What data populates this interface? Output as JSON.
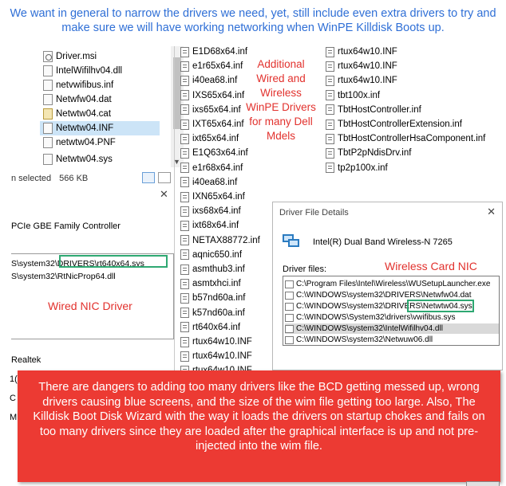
{
  "header": {
    "text": "We want in general to narrow the drivers we need, yet, still include even extra drivers to try and make sure we will have working networking when WinPE Killdisk Boots up."
  },
  "explorer": {
    "files": [
      {
        "name": "Driver.msi",
        "icon": "installer-icon"
      },
      {
        "name": "IntelWifilhv04.dll",
        "icon": "dll-icon"
      },
      {
        "name": "netvwifibus.inf",
        "icon": "inf-icon"
      },
      {
        "name": "Netwfw04.dat",
        "icon": "file-icon"
      },
      {
        "name": "Netwtw04.cat",
        "icon": "catalog-icon"
      },
      {
        "name": "Netwtw04.INF",
        "icon": "inf-icon",
        "selected": true
      },
      {
        "name": "netwtw04.PNF",
        "icon": "file-icon"
      },
      {
        "name": "Netwtw04.sys",
        "icon": "sys-icon"
      }
    ],
    "status": {
      "selected": "n selected",
      "size": "566 KB"
    }
  },
  "left_panel": {
    "device": "PCIe GBE Family Controller",
    "driver_rows": [
      "S\\system32\\DRIVERS\\rt640x64.sys",
      "S\\system32\\RtNicProp64.dll"
    ],
    "wired_label": "Wired NIC Driver",
    "provider": "Realtek",
    "stubs": [
      "1(",
      "C",
      "M"
    ]
  },
  "middle_files": [
    "E1D68x64.inf",
    "e1r65x64.inf",
    "i40ea68.inf",
    "IXS65x64.inf",
    "ixs65x64.inf",
    "IXT65x64.inf",
    "ixt65x64.inf",
    "E1Q63x64.inf",
    "e1r68x64.inf",
    "i40ea68.inf",
    "IXN65x64.inf",
    "ixs68x64.inf",
    "ixt68x64.inf",
    "NETAX88772.inf",
    "aqnic650.inf",
    "asmthub3.inf",
    "asmtxhci.inf",
    "b57nd60a.inf",
    "k57nd60a.inf",
    "rt640x64.inf",
    "rtux64w10.INF",
    "rtux64w10.INF",
    "rtux64w10.INF"
  ],
  "additional_label": "Additional Wired and Wireless WinPE Drivers for many Dell Mdels",
  "right_files": [
    "rtux64w10.INF",
    "rtux64w10.INF",
    "rtux64w10.INF",
    "tbt100x.inf",
    "TbtHostController.inf",
    "TbtHostControllerExtension.inf",
    "TbtHostControllerHsaComponent.inf",
    "TbtP2pNdisDrv.inf",
    "tp2p100x.inf"
  ],
  "dialog": {
    "title": "Driver File Details",
    "close": "✕",
    "device": "Intel(R) Dual Band Wireless-N 7265",
    "files_label": "Driver files:",
    "wireless_label": "Wireless Card NIC",
    "files": [
      "C:\\Program Files\\Intel\\Wireless\\WUSetupLauncher.exe",
      "C:\\WINDOWS\\system32\\DRIVERS\\Netwfw04.dat",
      "C:\\WINDOWS\\system32\\DRIVERS\\Netwtw04.sys",
      "C:\\WINDOWS\\System32\\drivers\\vwifibus.sys",
      "C:\\WINDOWS\\system32\\IntelWifilhv04.dll",
      "C:\\WINDOWS\\system32\\Netwuw06.dll"
    ]
  },
  "warning": {
    "text": "There are dangers to adding too many drivers like the BCD getting messed up, wrong drivers causing blue screens, and the size of the wim file getting too large. Also, The Killdisk Boot Disk Wizard with the way it loads the drivers on startup chokes and fails on too many drivers since they are loaded after the graphical interface is up and not pre-injected into the wim file."
  },
  "colors": {
    "annotation_red": "#e2312d",
    "header_blue": "#2f6fd6",
    "highlight_green": "#2ea872",
    "banner_red": "#ec3a33"
  }
}
